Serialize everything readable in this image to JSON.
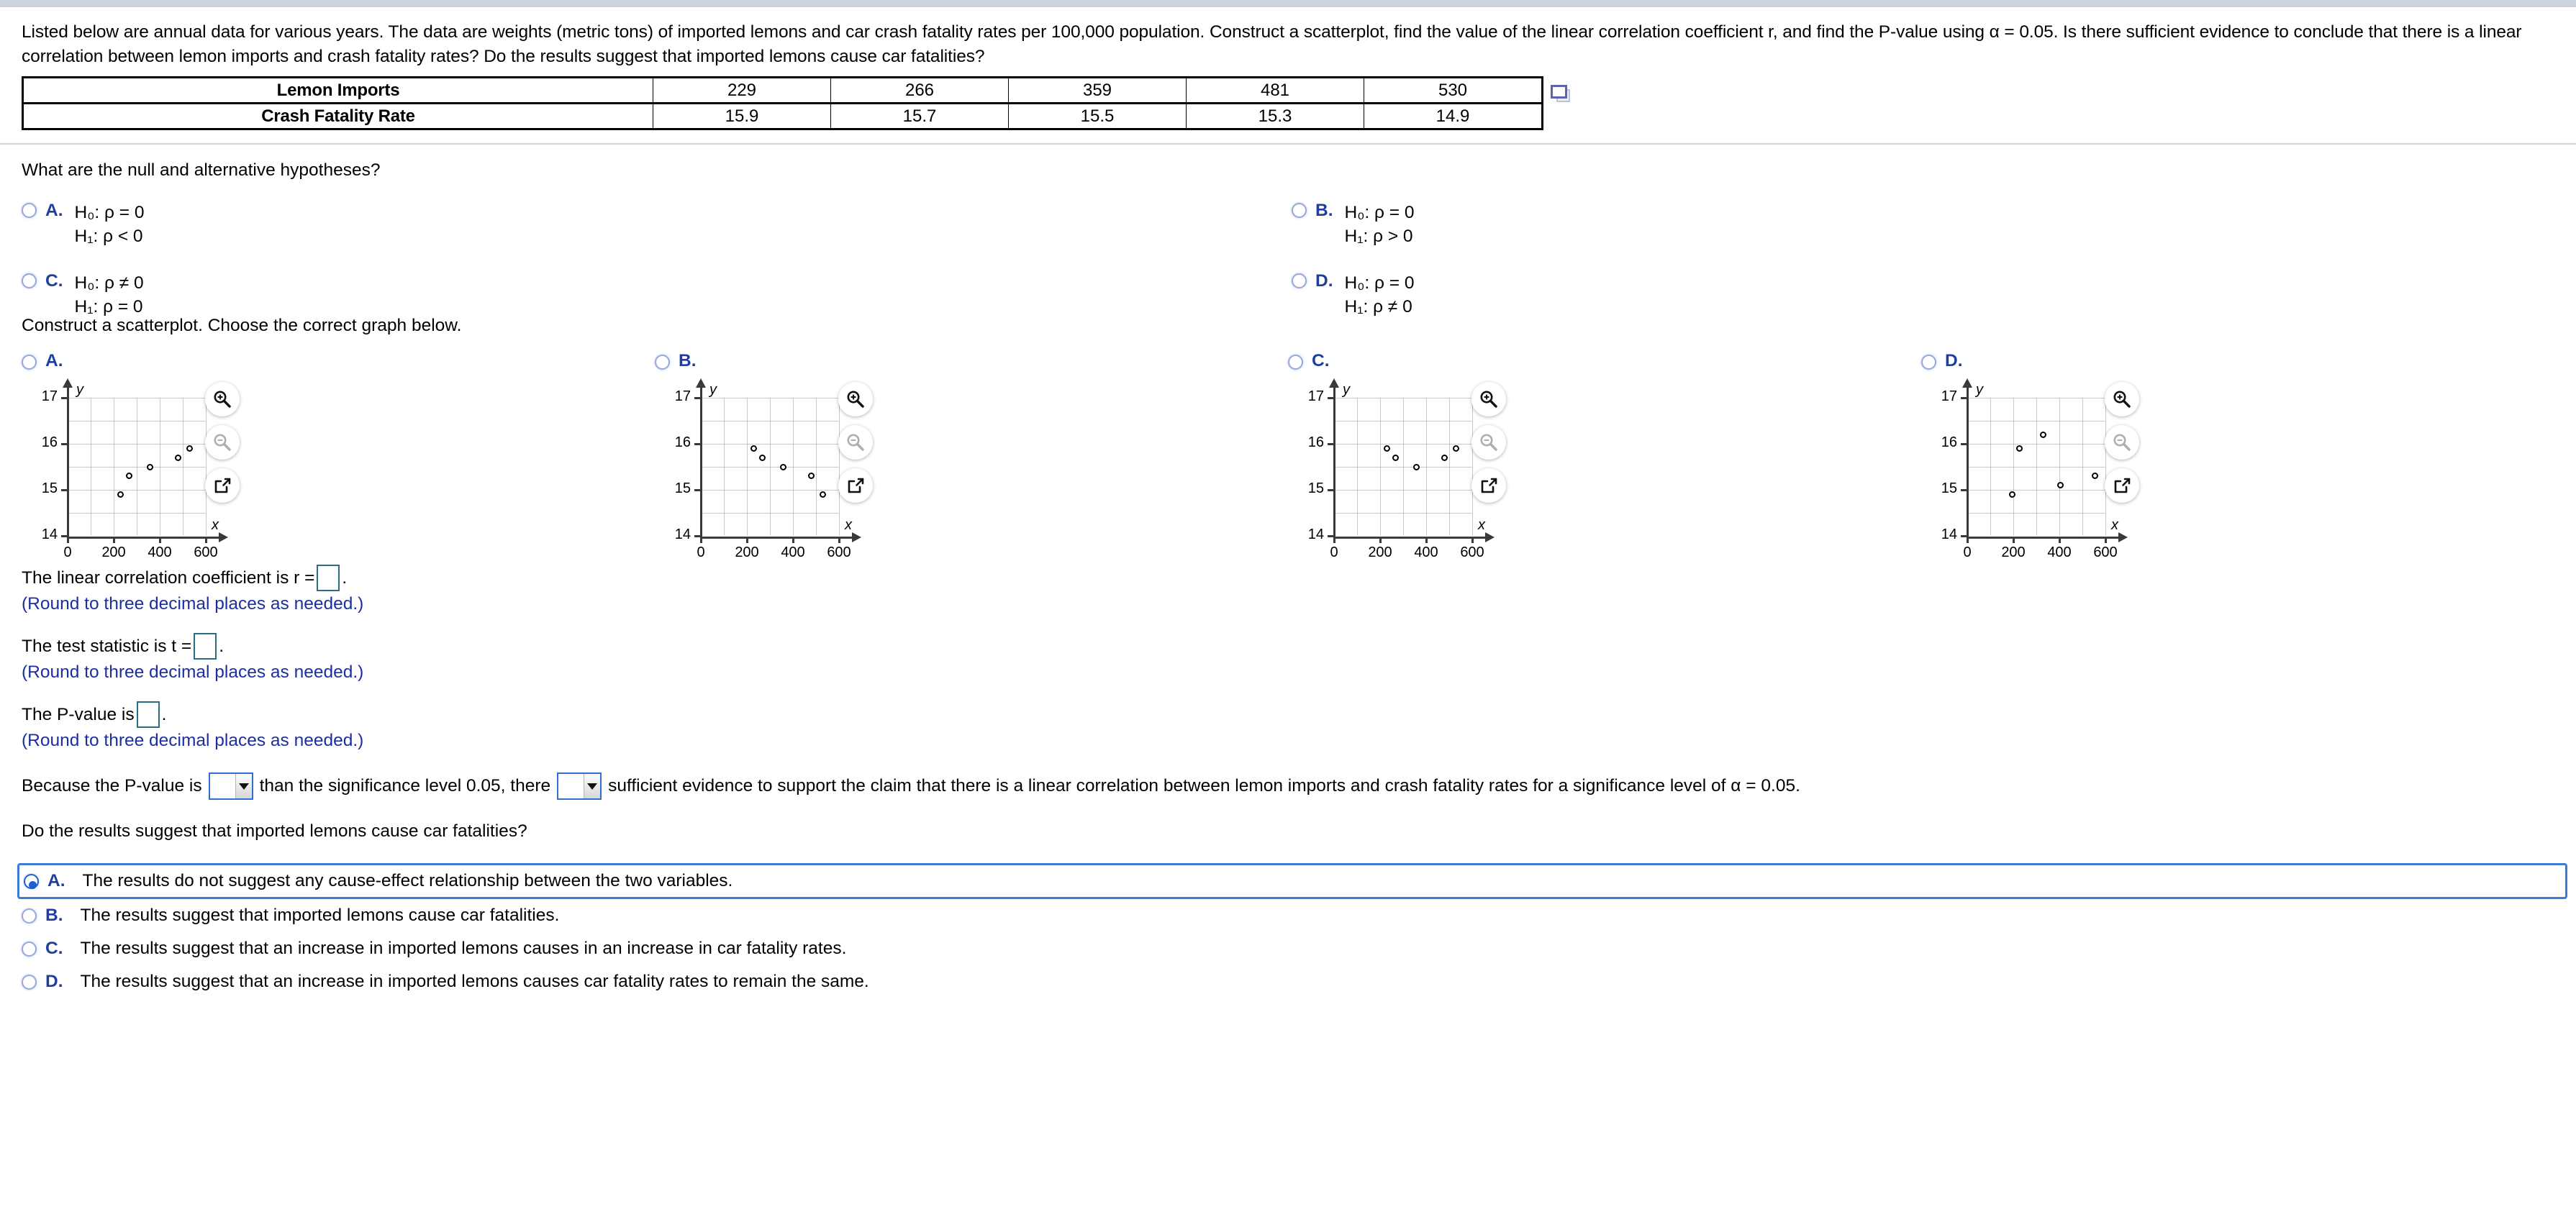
{
  "prompt": "Listed below are annual data for various years. The data are weights (metric tons) of imported lemons and car crash fatality rates per 100,000 population. Construct a scatterplot, find the value of the linear correlation coefficient r, and find the P-value using α = 0.05. Is there sufficient evidence to conclude that there is a linear correlation between lemon imports and crash fatality rates? Do the results suggest that imported lemons cause car fatalities?",
  "table": {
    "rows": [
      {
        "label": "Lemon Imports",
        "values": [
          "229",
          "266",
          "359",
          "481",
          "530"
        ]
      },
      {
        "label": "Crash Fatality Rate",
        "values": [
          "15.9",
          "15.7",
          "15.5",
          "15.3",
          "14.9"
        ]
      }
    ],
    "copy_icon": "copy-to-clipboard-icon"
  },
  "hypotheses": {
    "question": "What are the null and alternative hypotheses?",
    "options": [
      {
        "letter": "A.",
        "null": "H₀: ρ = 0",
        "alt": "H₁: ρ < 0",
        "selected": false
      },
      {
        "letter": "B.",
        "null": "H₀: ρ = 0",
        "alt": "H₁: ρ > 0",
        "selected": false
      },
      {
        "letter": "C.",
        "null": "H₀: ρ ≠ 0",
        "alt": "H₁: ρ = 0",
        "selected": false
      },
      {
        "letter": "D.",
        "null": "H₀: ρ = 0",
        "alt": "H₁: ρ ≠ 0",
        "selected": false
      }
    ]
  },
  "scatterplot": {
    "question": "Construct a scatterplot. Choose the correct graph below.",
    "tools": [
      "zoom-in-icon",
      "zoom-out-icon",
      "pop-out-icon"
    ],
    "options": [
      {
        "letter": "A.",
        "selected": false
      },
      {
        "letter": "B.",
        "selected": false
      },
      {
        "letter": "C.",
        "selected": false
      },
      {
        "letter": "D.",
        "selected": false
      }
    ]
  },
  "chart_data": [
    {
      "type": "scatter",
      "title": "A.",
      "xlabel": "x",
      "ylabel": "y",
      "xlim": [
        0,
        600
      ],
      "ylim": [
        14,
        17
      ],
      "xticks": [
        0,
        200,
        400,
        600
      ],
      "yticks": [
        14,
        15,
        16,
        17
      ],
      "xtick_labels": [
        "0",
        "200",
        "400",
        "600"
      ],
      "ytick_labels": [
        "14",
        "15",
        "16",
        "17"
      ],
      "grid": true,
      "grid_x_step": 100,
      "grid_y_step": 0.5,
      "x": [
        229,
        266,
        359,
        481,
        530
      ],
      "y": [
        14.9,
        15.3,
        15.5,
        15.7,
        15.9
      ]
    },
    {
      "type": "scatter",
      "title": "B.",
      "xlabel": "x",
      "ylabel": "y",
      "xlim": [
        0,
        600
      ],
      "ylim": [
        14,
        17
      ],
      "xticks": [
        0,
        200,
        400,
        600
      ],
      "yticks": [
        14,
        15,
        16,
        17
      ],
      "xtick_labels": [
        "0",
        "200",
        "400",
        "600"
      ],
      "ytick_labels": [
        "14",
        "15",
        "16",
        "17"
      ],
      "grid": true,
      "grid_x_step": 100,
      "grid_y_step": 0.5,
      "x": [
        229,
        266,
        359,
        481,
        530
      ],
      "y": [
        15.9,
        15.7,
        15.5,
        15.3,
        14.9
      ]
    },
    {
      "type": "scatter",
      "title": "C.",
      "xlabel": "x",
      "ylabel": "y",
      "xlim": [
        0,
        600
      ],
      "ylim": [
        14,
        17
      ],
      "xticks": [
        0,
        200,
        400,
        600
      ],
      "yticks": [
        14,
        15,
        16,
        17
      ],
      "xtick_labels": [
        "0",
        "200",
        "400",
        "600"
      ],
      "ytick_labels": [
        "14",
        "15",
        "16",
        "17"
      ],
      "grid": true,
      "grid_x_step": 100,
      "grid_y_step": 0.5,
      "x": [
        229,
        266,
        359,
        481,
        530
      ],
      "y": [
        15.9,
        15.7,
        15.5,
        15.7,
        15.9
      ]
    },
    {
      "type": "scatter",
      "title": "D.",
      "xlabel": "x",
      "ylabel": "y",
      "xlim": [
        0,
        600
      ],
      "ylim": [
        14,
        17
      ],
      "xticks": [
        0,
        200,
        400,
        600
      ],
      "yticks": [
        14,
        15,
        16,
        17
      ],
      "xtick_labels": [
        "0",
        "200",
        "400",
        "600"
      ],
      "ytick_labels": [
        "14",
        "15",
        "16",
        "17"
      ],
      "grid": true,
      "grid_x_step": 100,
      "grid_y_step": 0.5,
      "x": [
        195,
        225,
        330,
        405,
        555
      ],
      "y": [
        14.9,
        15.9,
        16.2,
        15.1,
        15.3
      ]
    }
  ],
  "answers": {
    "r_label_pre": "The linear correlation coefficient is r =",
    "r_label_post": ".",
    "r_value": "",
    "r_note": "(Round to three decimal places as needed.)",
    "t_label_pre": "The test statistic is t =",
    "t_label_post": ".",
    "t_value": "",
    "t_note": "(Round to three decimal places as needed.)",
    "p_label_pre": "The P-value is",
    "p_label_post": ".",
    "p_value": "",
    "p_note": "(Round to three decimal places as needed.)"
  },
  "conclusion": {
    "pre": "Because the P-value is",
    "dropdown1_value": "",
    "mid": "than the significance level 0.05, there",
    "dropdown2_value": "",
    "post": "sufficient evidence to support the claim that there is a linear correlation between lemon imports and crash fatality rates for a significance level of α = 0.05."
  },
  "final": {
    "question": "Do the results suggest that imported lemons cause car fatalities?",
    "options": [
      {
        "letter": "A.",
        "text": "The results do not suggest any cause-effect relationship between the two variables.",
        "selected": true
      },
      {
        "letter": "B.",
        "text": "The results suggest that imported lemons cause car fatalities.",
        "selected": false
      },
      {
        "letter": "C.",
        "text": "The results suggest that an increase in imported lemons causes in an increase in car fatality rates.",
        "selected": false
      },
      {
        "letter": "D.",
        "text": "The results suggest that an increase in imported lemons causes car fatality rates to remain the same.",
        "selected": false
      }
    ]
  },
  "colors": {
    "accent_blue": "#1f3f9e",
    "selected_border": "#3a7bd5",
    "blank_border": "#2a6b85",
    "note_blue": "#1c2fa0",
    "topbar": "#ccd2e0"
  }
}
